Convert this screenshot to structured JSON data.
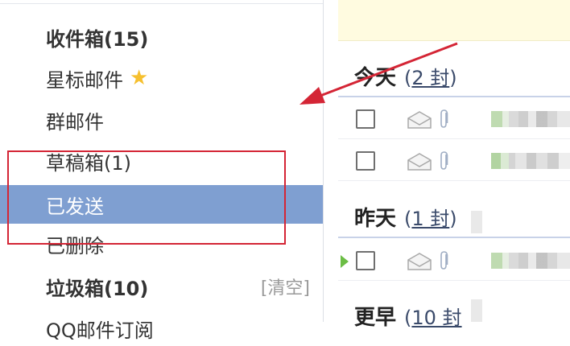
{
  "sidebar": {
    "folders": [
      {
        "label": "收件箱(15)",
        "bold": true
      },
      {
        "label": "星标邮件",
        "bold": false,
        "icon": "star-icon"
      },
      {
        "label": "群邮件",
        "bold": false
      },
      {
        "label": "草稿箱(1)",
        "bold": false
      },
      {
        "label": "已发送",
        "bold": false,
        "selected": true
      },
      {
        "label": "已删除",
        "bold": false
      },
      {
        "label": "垃圾箱(10)",
        "bold": true,
        "action": "[清空]"
      },
      {
        "label": "QQ邮件订阅",
        "bold": false
      }
    ]
  },
  "mail_list": {
    "groups": [
      {
        "title": "今天",
        "count_prefix": "(",
        "count": "2 封",
        "count_suffix": ")"
      },
      {
        "title": "昨天",
        "count_prefix": "(",
        "count": "1 封",
        "count_suffix": ")"
      },
      {
        "title": "更早",
        "count_prefix": "(",
        "count": "10 封",
        "count_suffix": ""
      }
    ]
  },
  "colors": {
    "selected_folder_bg": "#7f9fd1",
    "annotation_red": "#d42535",
    "star": "#f6c02f",
    "unread_flag": "#6bbd45"
  }
}
